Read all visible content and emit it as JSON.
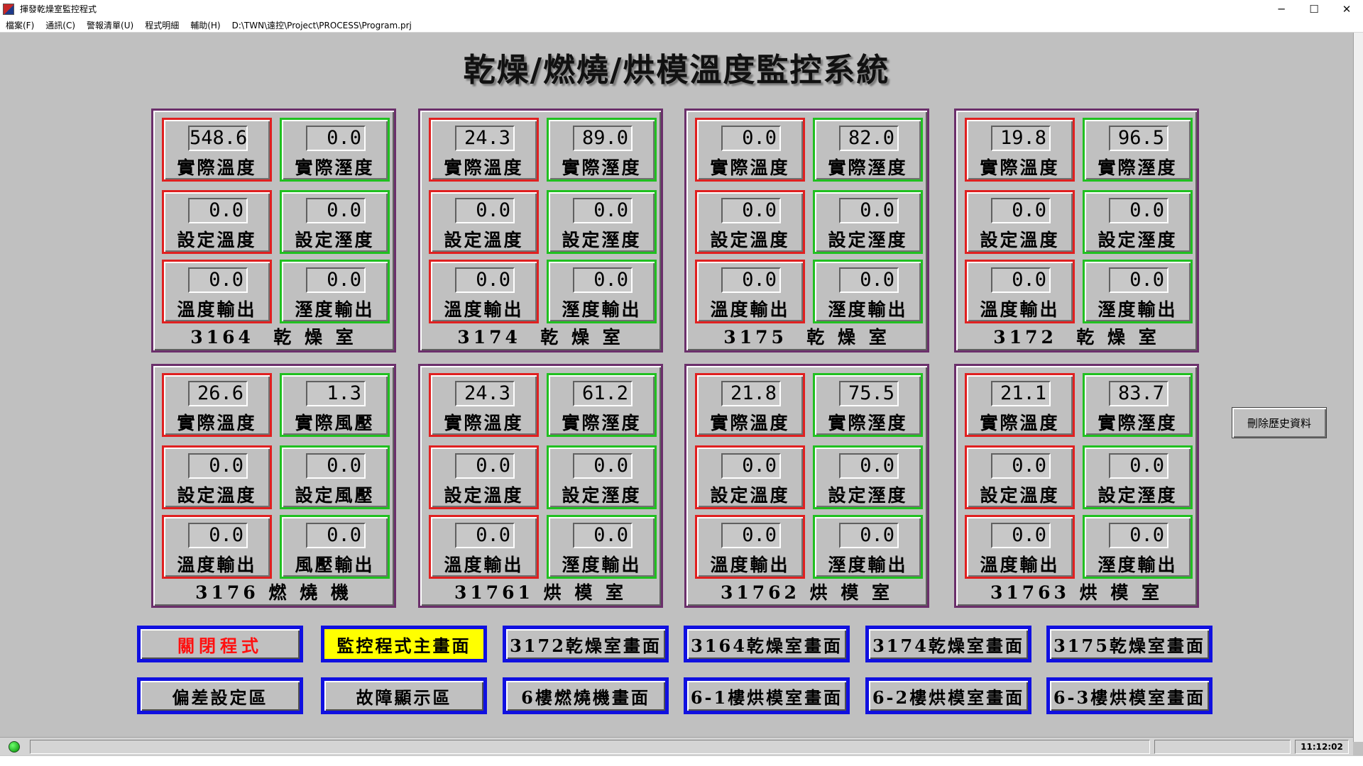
{
  "window": {
    "title": "揮發乾燥室監控程式",
    "minimize": "─",
    "maximize": "☐",
    "close": "✕"
  },
  "menu": {
    "items": [
      "檔案(F)",
      "通訊(C)",
      "警報清單(U)",
      "程式明細",
      "輔助(H)"
    ],
    "path": "D:\\TWN\\遠控\\Project\\PROCESS\\Program.prj"
  },
  "main_title": "乾燥/燃燒/烘模溫度監控系統",
  "panels": [
    {
      "label": "3164  乾 燥 室",
      "tiles": [
        {
          "value": "548.6",
          "label": "實際溫度"
        },
        {
          "value": "0.0",
          "label": "實際溼度"
        },
        {
          "value": "0.0",
          "label": "設定溫度"
        },
        {
          "value": "0.0",
          "label": "設定溼度"
        },
        {
          "value": "0.0",
          "label": "溫度輸出"
        },
        {
          "value": "0.0",
          "label": "溼度輸出"
        }
      ]
    },
    {
      "label": "3174  乾 燥 室",
      "tiles": [
        {
          "value": "24.3",
          "label": "實際溫度"
        },
        {
          "value": "89.0",
          "label": "實際溼度"
        },
        {
          "value": "0.0",
          "label": "設定溫度"
        },
        {
          "value": "0.0",
          "label": "設定溼度"
        },
        {
          "value": "0.0",
          "label": "溫度輸出"
        },
        {
          "value": "0.0",
          "label": "溼度輸出"
        }
      ]
    },
    {
      "label": "3175  乾 燥 室",
      "tiles": [
        {
          "value": "0.0",
          "label": "實際溫度"
        },
        {
          "value": "82.0",
          "label": "實際溼度"
        },
        {
          "value": "0.0",
          "label": "設定溫度"
        },
        {
          "value": "0.0",
          "label": "設定溼度"
        },
        {
          "value": "0.0",
          "label": "溫度輸出"
        },
        {
          "value": "0.0",
          "label": "溼度輸出"
        }
      ]
    },
    {
      "label": "3172  乾 燥 室",
      "tiles": [
        {
          "value": "19.8",
          "label": "實際溫度"
        },
        {
          "value": "96.5",
          "label": "實際溼度"
        },
        {
          "value": "0.0",
          "label": "設定溫度"
        },
        {
          "value": "0.0",
          "label": "設定溼度"
        },
        {
          "value": "0.0",
          "label": "溫度輸出"
        },
        {
          "value": "0.0",
          "label": "溼度輸出"
        }
      ]
    },
    {
      "label": "3176 燃 燒 機",
      "tiles": [
        {
          "value": "26.6",
          "label": "實際溫度"
        },
        {
          "value": "1.3",
          "label": "實際風壓"
        },
        {
          "value": "0.0",
          "label": "設定溫度"
        },
        {
          "value": "0.0",
          "label": "設定風壓"
        },
        {
          "value": "0.0",
          "label": "溫度輸出"
        },
        {
          "value": "0.0",
          "label": "風壓輸出"
        }
      ]
    },
    {
      "label": "31761 烘 模 室",
      "tiles": [
        {
          "value": "24.3",
          "label": "實際溫度"
        },
        {
          "value": "61.2",
          "label": "實際溼度"
        },
        {
          "value": "0.0",
          "label": "設定溫度"
        },
        {
          "value": "0.0",
          "label": "設定溼度"
        },
        {
          "value": "0.0",
          "label": "溫度輸出"
        },
        {
          "value": "0.0",
          "label": "溼度輸出"
        }
      ]
    },
    {
      "label": "31762 烘 模 室",
      "tiles": [
        {
          "value": "21.8",
          "label": "實際溫度"
        },
        {
          "value": "75.5",
          "label": "實際溼度"
        },
        {
          "value": "0.0",
          "label": "設定溫度"
        },
        {
          "value": "0.0",
          "label": "設定溼度"
        },
        {
          "value": "0.0",
          "label": "溫度輸出"
        },
        {
          "value": "0.0",
          "label": "溼度輸出"
        }
      ]
    },
    {
      "label": "31763 烘 模 室",
      "tiles": [
        {
          "value": "21.1",
          "label": "實際溫度"
        },
        {
          "value": "83.7",
          "label": "實際溼度"
        },
        {
          "value": "0.0",
          "label": "設定溫度"
        },
        {
          "value": "0.0",
          "label": "設定溼度"
        },
        {
          "value": "0.0",
          "label": "溫度輸出"
        },
        {
          "value": "0.0",
          "label": "溼度輸出"
        }
      ]
    }
  ],
  "side": {
    "delete_history": "刪除歷史資料"
  },
  "nav": {
    "row1": [
      "關閉程式",
      "監控程式主畫面",
      "3172乾燥室畫面",
      "3164乾燥室畫面",
      "3174乾燥室畫面",
      "3175乾燥室畫面"
    ],
    "row2": [
      "偏差設定區",
      "故障顯示區",
      "6樓燃燒機畫面",
      "6-1樓烘模室畫面",
      "6-2樓烘模室畫面",
      "6-3樓烘模室畫面"
    ]
  },
  "status": {
    "time": "11:12:02"
  },
  "colors": {
    "temp_border": "#e02020",
    "humidity_border": "#20c020",
    "panel_border": "#6b2f6b",
    "nav_border": "#1010e0",
    "close_text": "#ff1010",
    "main_highlight": "#ffff00",
    "status_ok": "#00c000"
  }
}
